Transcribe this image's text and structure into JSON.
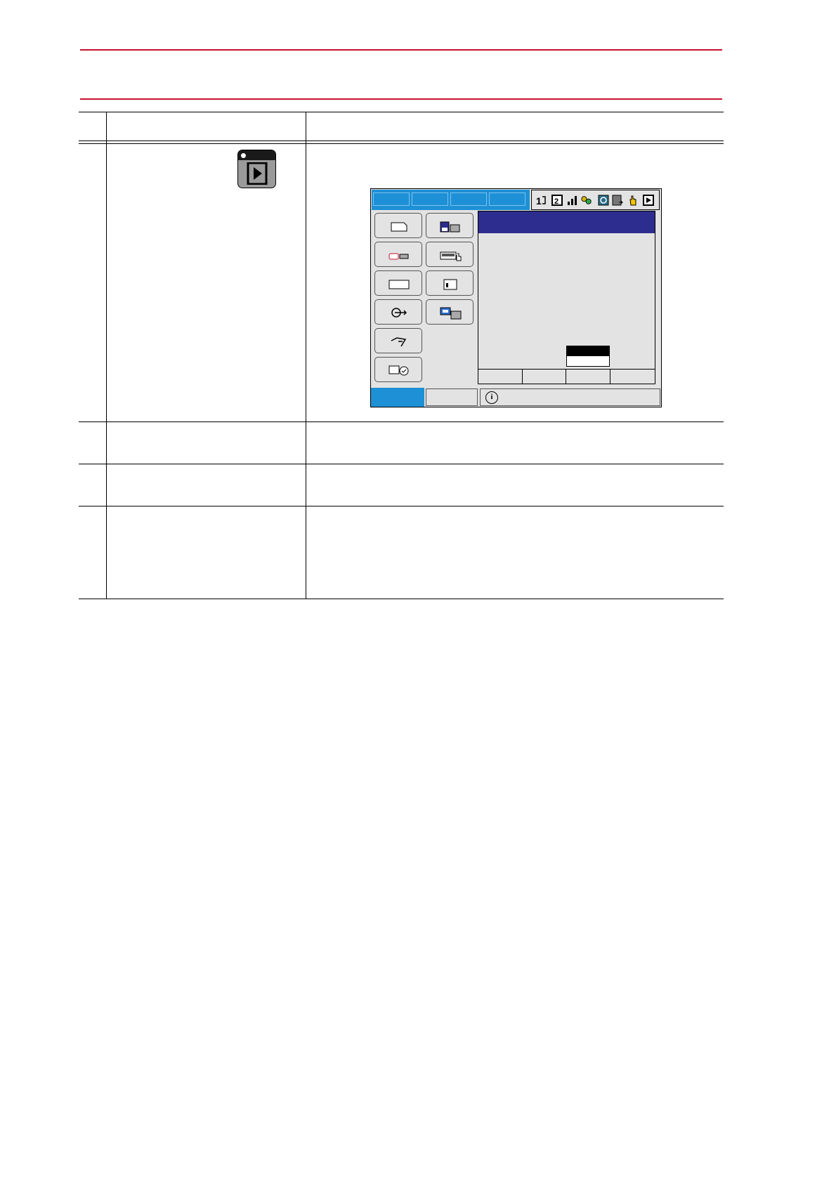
{
  "document": {
    "header_rule_color": "#c8102e"
  },
  "procedure_table": {
    "rows": [
      {
        "step": "",
        "operation": "",
        "explanation": ""
      },
      {
        "step": "",
        "operation": "",
        "explanation": "",
        "key_icon": "play-mode-key-icon"
      },
      {
        "step": "",
        "operation": "",
        "explanation": ""
      },
      {
        "step": "",
        "operation": "",
        "explanation": ""
      },
      {
        "step": "",
        "operation": "",
        "explanation": ""
      }
    ]
  },
  "screen": {
    "accent_color": "#1e90d6",
    "header_color": "#2d2d8f",
    "status_icons": [
      "robot-axis-icon",
      "coordinate-icon",
      "speed-icon",
      "servo-icon",
      "cycle-icon",
      "program-icon",
      "hand-icon",
      "play-icon"
    ],
    "main_menu_left": [
      "job-icon",
      "robot-icon",
      "in-out-icon",
      "arc-welding-icon",
      "variable-icon",
      "system-info-icon"
    ],
    "main_menu_right": [
      "external-memory-icon",
      "setup-icon",
      "display-setup-icon",
      "display-icon"
    ],
    "message_icon": "info-icon"
  }
}
